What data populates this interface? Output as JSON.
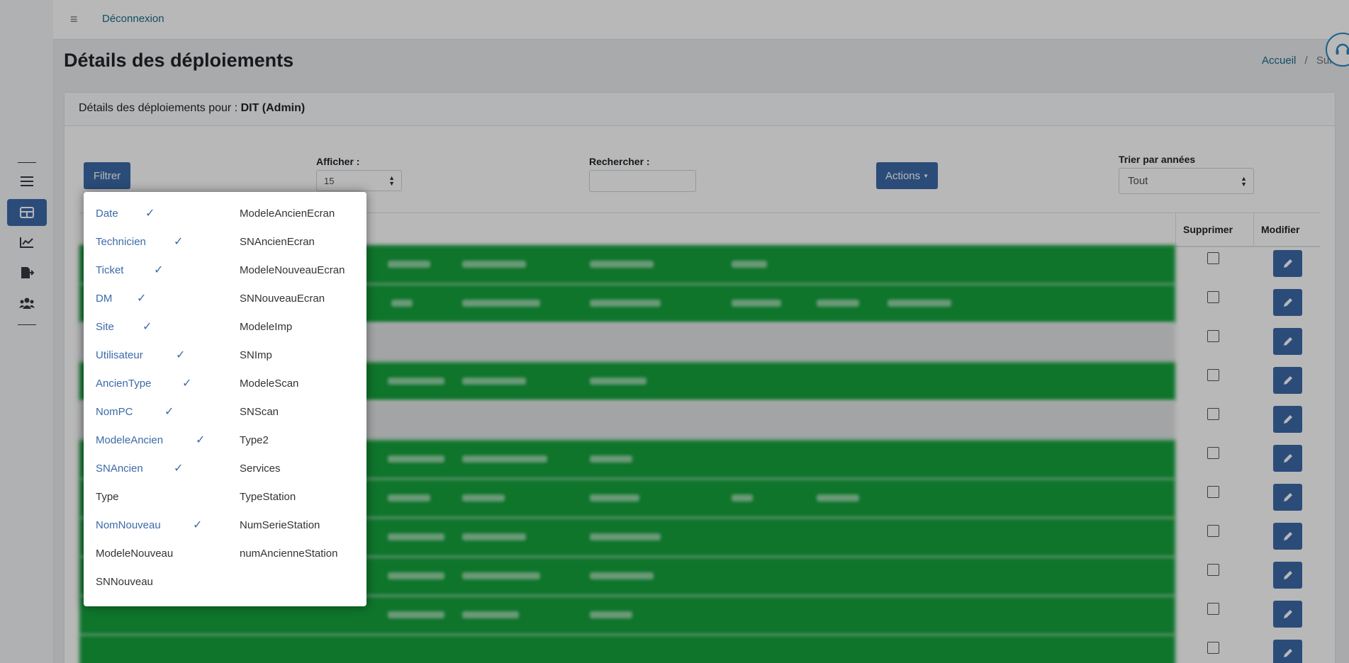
{
  "topbar": {
    "menu_glyph": "≡",
    "logout_label": "Déconnexion"
  },
  "page": {
    "title": "Détails des déploiements"
  },
  "breadcrumb": {
    "home": "Accueil",
    "separator": "/",
    "current": "Sui"
  },
  "card": {
    "header_prefix": "Détails des déploiements pour :",
    "header_entity": "DIT (Admin)"
  },
  "toolbar": {
    "filter_label": "Filtrer",
    "show_label": "Afficher :",
    "show_value": "15",
    "search_label": "Rechercher :",
    "search_value": "",
    "actions_label": "Actions",
    "sort_label": "Trier par années",
    "sort_value": "Tout"
  },
  "table": {
    "columns": [
      "Supprimer",
      "Modifier"
    ]
  },
  "filter_menu": {
    "check_glyph": "✓",
    "left": [
      {
        "label": "Date",
        "checked": true
      },
      {
        "label": "Technicien",
        "checked": true
      },
      {
        "label": "Ticket",
        "checked": true
      },
      {
        "label": "DM",
        "checked": true
      },
      {
        "label": "Site",
        "checked": true
      },
      {
        "label": "Utilisateur",
        "checked": true
      },
      {
        "label": "AncienType",
        "checked": true
      },
      {
        "label": "NomPC",
        "checked": true
      },
      {
        "label": "ModeleAncien",
        "checked": true
      },
      {
        "label": "SNAncien",
        "checked": true
      },
      {
        "label": "Type",
        "checked": false
      },
      {
        "label": "NomNouveau",
        "checked": true
      },
      {
        "label": "ModeleNouveau",
        "checked": false
      },
      {
        "label": "SNNouveau",
        "checked": false
      }
    ],
    "right": [
      {
        "label": "ModeleAncienEcran",
        "checked": false
      },
      {
        "label": "SNAncienEcran",
        "checked": false
      },
      {
        "label": "ModeleNouveauEcran",
        "checked": false
      },
      {
        "label": "SNNouveauEcran",
        "checked": false
      },
      {
        "label": "ModeleImp",
        "checked": false
      },
      {
        "label": "SNImp",
        "checked": false
      },
      {
        "label": "ModeleScan",
        "checked": false
      },
      {
        "label": "SNScan",
        "checked": false
      },
      {
        "label": "Type2",
        "checked": false
      },
      {
        "label": "Services",
        "checked": false
      },
      {
        "label": "TypeStation",
        "checked": false
      },
      {
        "label": "NumSerieStation",
        "checked": false
      },
      {
        "label": "numAncienneStation",
        "checked": false
      }
    ]
  },
  "colors": {
    "primary": "#3c6aa8",
    "row_green": "#14a23c",
    "link": "#1e6a8a"
  }
}
